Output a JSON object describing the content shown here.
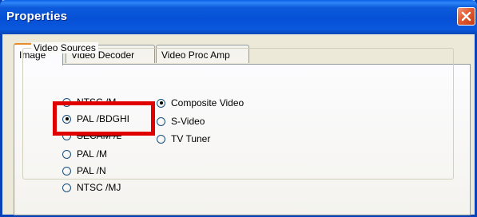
{
  "window": {
    "title": "Properties",
    "close_icon": "close-x-icon"
  },
  "tabs": [
    {
      "label": "Image",
      "selected": true
    },
    {
      "label": "Video Decoder",
      "selected": false
    },
    {
      "label": "Video Proc Amp",
      "selected": false
    }
  ],
  "video_sources": {
    "group_label": "Video Sources",
    "standards": [
      {
        "label": "NTSC /M",
        "selected": false
      },
      {
        "label": "PAL /BDGHI",
        "selected": true
      },
      {
        "label": "SECAM /L",
        "selected": false
      },
      {
        "label": "PAL /M",
        "selected": false
      },
      {
        "label": "PAL /N",
        "selected": false
      },
      {
        "label": "NTSC /MJ",
        "selected": false
      }
    ],
    "inputs": [
      {
        "label": "Composite Video",
        "selected": true
      },
      {
        "label": "S-Video",
        "selected": false
      },
      {
        "label": "TV Tuner",
        "selected": false
      }
    ]
  },
  "colors": {
    "titlebar": "#0650d5",
    "highlight_box": "#e10000",
    "tab_accent": "#e68b2c"
  }
}
